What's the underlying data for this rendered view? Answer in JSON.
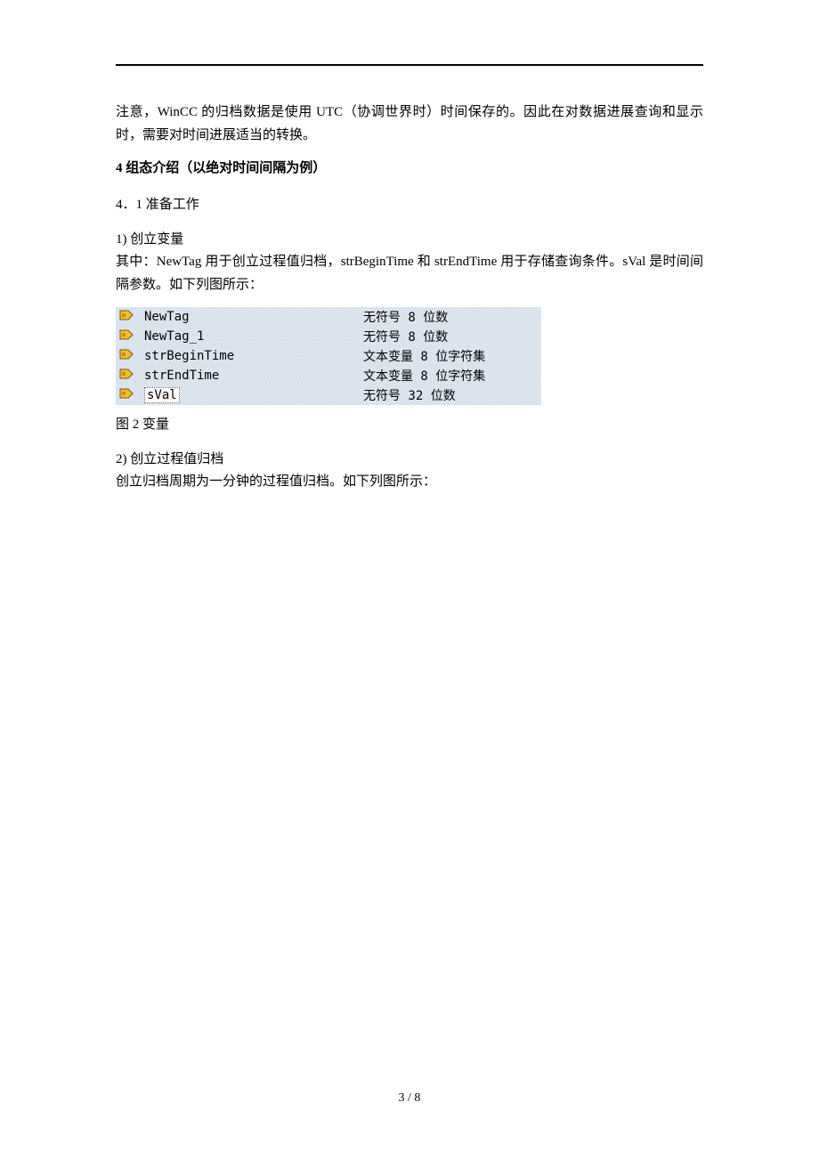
{
  "para_intro": "注意，WinCC 的归档数据是使用 UTC（协调世界时）时间保存的。因此在对数据进展查询和显示时，需要对时间进展适当的转换。",
  "heading4": "4 组态介绍（以绝对时间间隔为例）",
  "sub_4_1": "4．1 准备工作",
  "item1_title": "1) 创立变量",
  "item1_body": "其中：NewTag 用于创立过程值归档，strBeginTime 和 strEndTime 用于存储查询条件。sVal 是时间间隔参数。如下列图所示：",
  "figure_caption": "图 2 变量",
  "item2_title": "2)  创立过程值归档",
  "item2_body": "创立归档周期为一分钟的过程值归档。如下列图所示：",
  "vars": [
    {
      "name": "NewTag",
      "type": "无符号 8 位数"
    },
    {
      "name": "NewTag_1",
      "type": "无符号 8 位数"
    },
    {
      "name": "strBeginTime",
      "type": "文本变量 8 位字符集"
    },
    {
      "name": "strEndTime",
      "type": "文本变量 8 位字符集"
    },
    {
      "name": "sVal",
      "type": "无符号 32 位数"
    }
  ],
  "pagenum": "3 / 8"
}
